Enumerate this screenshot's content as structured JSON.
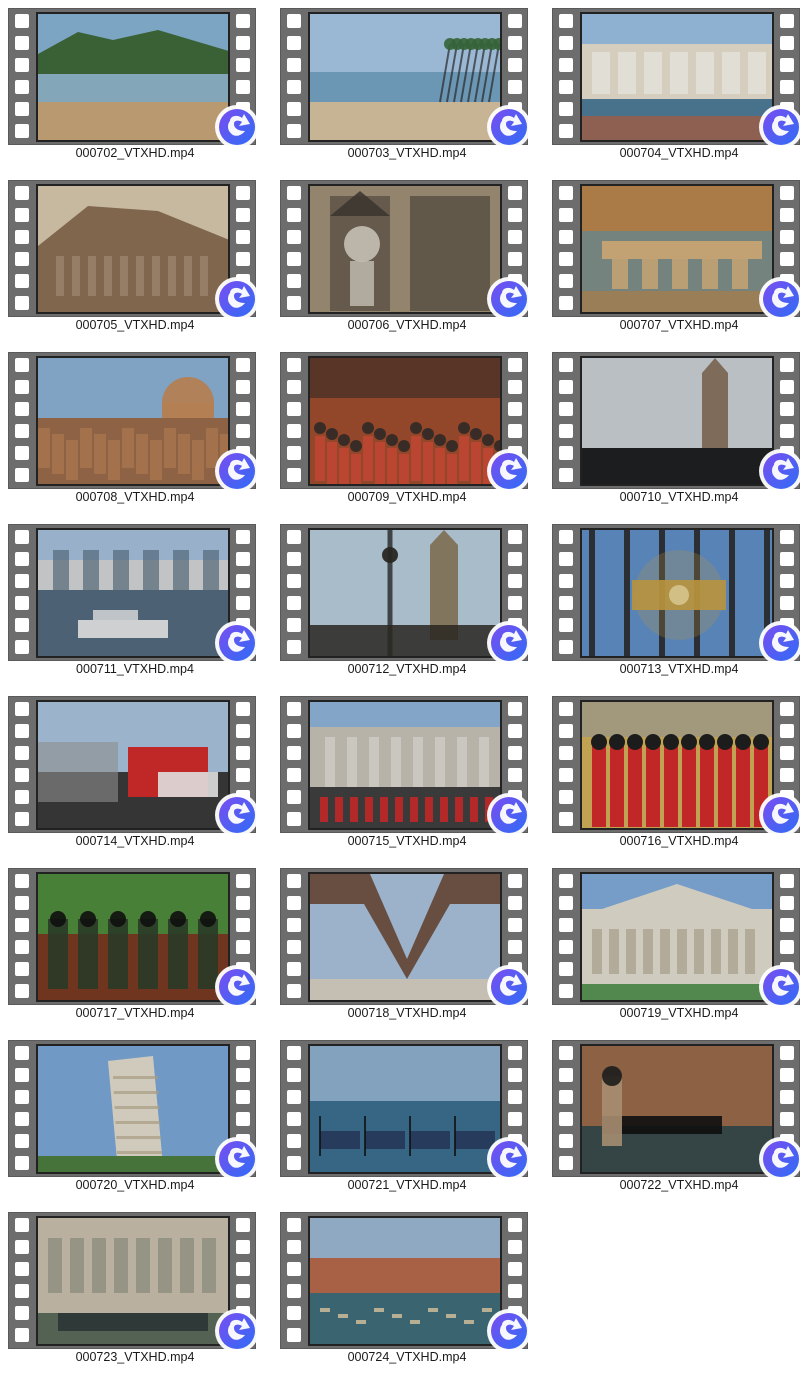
{
  "files": [
    {
      "name": "000702_VTXHD.mp4",
      "scene": "beach-with-mountain",
      "palette": [
        "#87b2d4",
        "#3f6a3a",
        "#c9a77a",
        "#8fb6c7"
      ]
    },
    {
      "name": "000703_VTXHD.mp4",
      "scene": "beach-palms",
      "palette": [
        "#a8c8e6",
        "#3a6b3b",
        "#d7c4a1",
        "#6f9fc0"
      ]
    },
    {
      "name": "000704_VTXHD.mp4",
      "scene": "seaside-hotels",
      "palette": [
        "#9cc1e3",
        "#e8e0cf",
        "#b9623f",
        "#4f7b98"
      ]
    },
    {
      "name": "000705_VTXHD.mp4",
      "scene": "cathedral-facade",
      "palette": [
        "#7ea6cf",
        "#d7c9ae",
        "#8d6f55",
        "#b19a80"
      ]
    },
    {
      "name": "000706_VTXHD.mp4",
      "scene": "statue-niche",
      "palette": [
        "#d6d1c4",
        "#9f9077",
        "#5e5347",
        "#3f3932"
      ]
    },
    {
      "name": "000707_VTXHD.mp4",
      "scene": "river-bridge",
      "palette": [
        "#6d8d5a",
        "#b9864e",
        "#d3b07d",
        "#7f8f8a"
      ]
    },
    {
      "name": "000708_VTXHD.mp4",
      "scene": "city-dome",
      "palette": [
        "#8bb0d4",
        "#9b6b4a",
        "#c38a5b",
        "#4c6c46"
      ]
    },
    {
      "name": "000709_VTXHD.mp4",
      "scene": "crowd-street",
      "palette": [
        "#9f4d2e",
        "#d84c3a",
        "#e3b08a",
        "#2d2b2a"
      ]
    },
    {
      "name": "000710_VTXHD.mp4",
      "scene": "clock-tower-crowd",
      "palette": [
        "#c9d0d4",
        "#8a7561",
        "#3e4b3f",
        "#1f2021"
      ]
    },
    {
      "name": "000711_VTXHD.mp4",
      "scene": "river-building-boats",
      "palette": [
        "#a6bfdc",
        "#d2d4d6",
        "#536a7d",
        "#f0f0f0"
      ]
    },
    {
      "name": "000712_VTXHD.mp4",
      "scene": "clock-tower-lamp",
      "palette": [
        "#b8ccdc",
        "#8e7f67",
        "#3a3c3e",
        "#2d2a25"
      ]
    },
    {
      "name": "000713_VTXHD.mp4",
      "scene": "ornate-gate-crest",
      "palette": [
        "#5f8fc6",
        "#c9a143",
        "#2a2a2a",
        "#e7d59a"
      ]
    },
    {
      "name": "000714_VTXHD.mp4",
      "scene": "red-bus-street",
      "palette": [
        "#a9c3dd",
        "#d12b2b",
        "#f2f2f2",
        "#3a3a3a"
      ]
    },
    {
      "name": "000715_VTXHD.mp4",
      "scene": "palace-guards",
      "palette": [
        "#8fb5da",
        "#c8c3b7",
        "#d22b2b",
        "#3f3f3f"
      ]
    },
    {
      "name": "000716_VTXHD.mp4",
      "scene": "marching-band",
      "palette": [
        "#d22b2b",
        "#1f1f1f",
        "#d2b059",
        "#9aa1a8"
      ]
    },
    {
      "name": "000717_VTXHD.mp4",
      "scene": "bagpipers",
      "palette": [
        "#4f8b3c",
        "#7a3a22",
        "#2d3f2a",
        "#c36d4f"
      ]
    },
    {
      "name": "000718_VTXHD.mp4",
      "scene": "eiffel-arch",
      "palette": [
        "#a9c2dc",
        "#6d4f3d",
        "#3f3a37",
        "#d8d0c0"
      ]
    },
    {
      "name": "000719_VTXHD.mp4",
      "scene": "pisa-cathedral",
      "palette": [
        "#80abd8",
        "#e2ddd0",
        "#a79c87",
        "#5a9454"
      ]
    },
    {
      "name": "000720_VTXHD.mp4",
      "scene": "leaning-tower",
      "palette": [
        "#7aa8d6",
        "#e2dccd",
        "#b8a98d",
        "#4b7d3f"
      ]
    },
    {
      "name": "000721_VTXHD.mp4",
      "scene": "gondolas-lagoon",
      "palette": [
        "#8fb0cf",
        "#2a3f63",
        "#3b6f8f",
        "#1f1f1f"
      ]
    },
    {
      "name": "000722_VTXHD.mp4",
      "scene": "venice-canal-gondolier",
      "palette": [
        "#9a6a4a",
        "#3a4a4a",
        "#b59a7b",
        "#1f1f1f"
      ]
    },
    {
      "name": "000723_VTXHD.mp4",
      "scene": "venice-palazzo-boat",
      "palette": [
        "#c9bfae",
        "#5b6b5a",
        "#2f3b3a",
        "#b7a587"
      ]
    },
    {
      "name": "000724_VTXHD.mp4",
      "scene": "grand-canal",
      "palette": [
        "#9cb8d4",
        "#b86a4d",
        "#3e6d7a",
        "#d6c6a5"
      ]
    }
  ],
  "colors": {
    "film_gray": "#6d6d6d",
    "label_text": "#1a1a1a",
    "badge_blue": "#2f6cf4",
    "badge_purple": "#7a4df2"
  },
  "icons": {
    "badge": "share-arrow-icon"
  }
}
